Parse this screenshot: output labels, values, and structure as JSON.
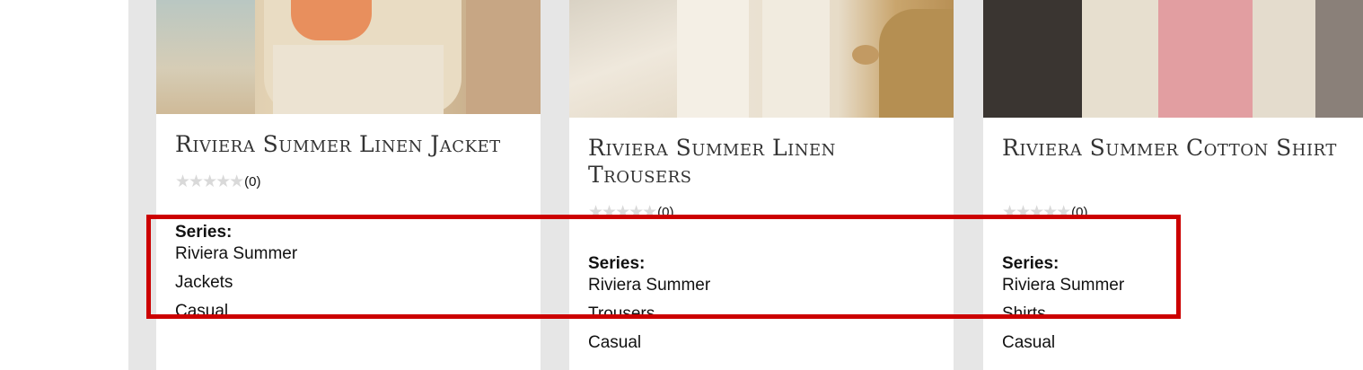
{
  "products": [
    {
      "title": "Riviera Summer Linen Jacket",
      "rating_count": "(0)",
      "series_label": "Series:",
      "series": "Riviera Summer",
      "category": "Jackets",
      "style": "Casual"
    },
    {
      "title": "Riviera Summer Linen Trousers",
      "rating_count": "(0)",
      "series_label": "Series:",
      "series": "Riviera Summer",
      "category": "Trousers",
      "style": "Casual"
    },
    {
      "title": "Riviera Summer Cotton Shirt",
      "rating_count": "(0)",
      "series_label": "Series:",
      "series": "Riviera Summer",
      "category": "Shirts",
      "style": "Casual"
    }
  ],
  "stars": "★★★★★",
  "rating_value": 0,
  "highlight_color": "#cc0000"
}
